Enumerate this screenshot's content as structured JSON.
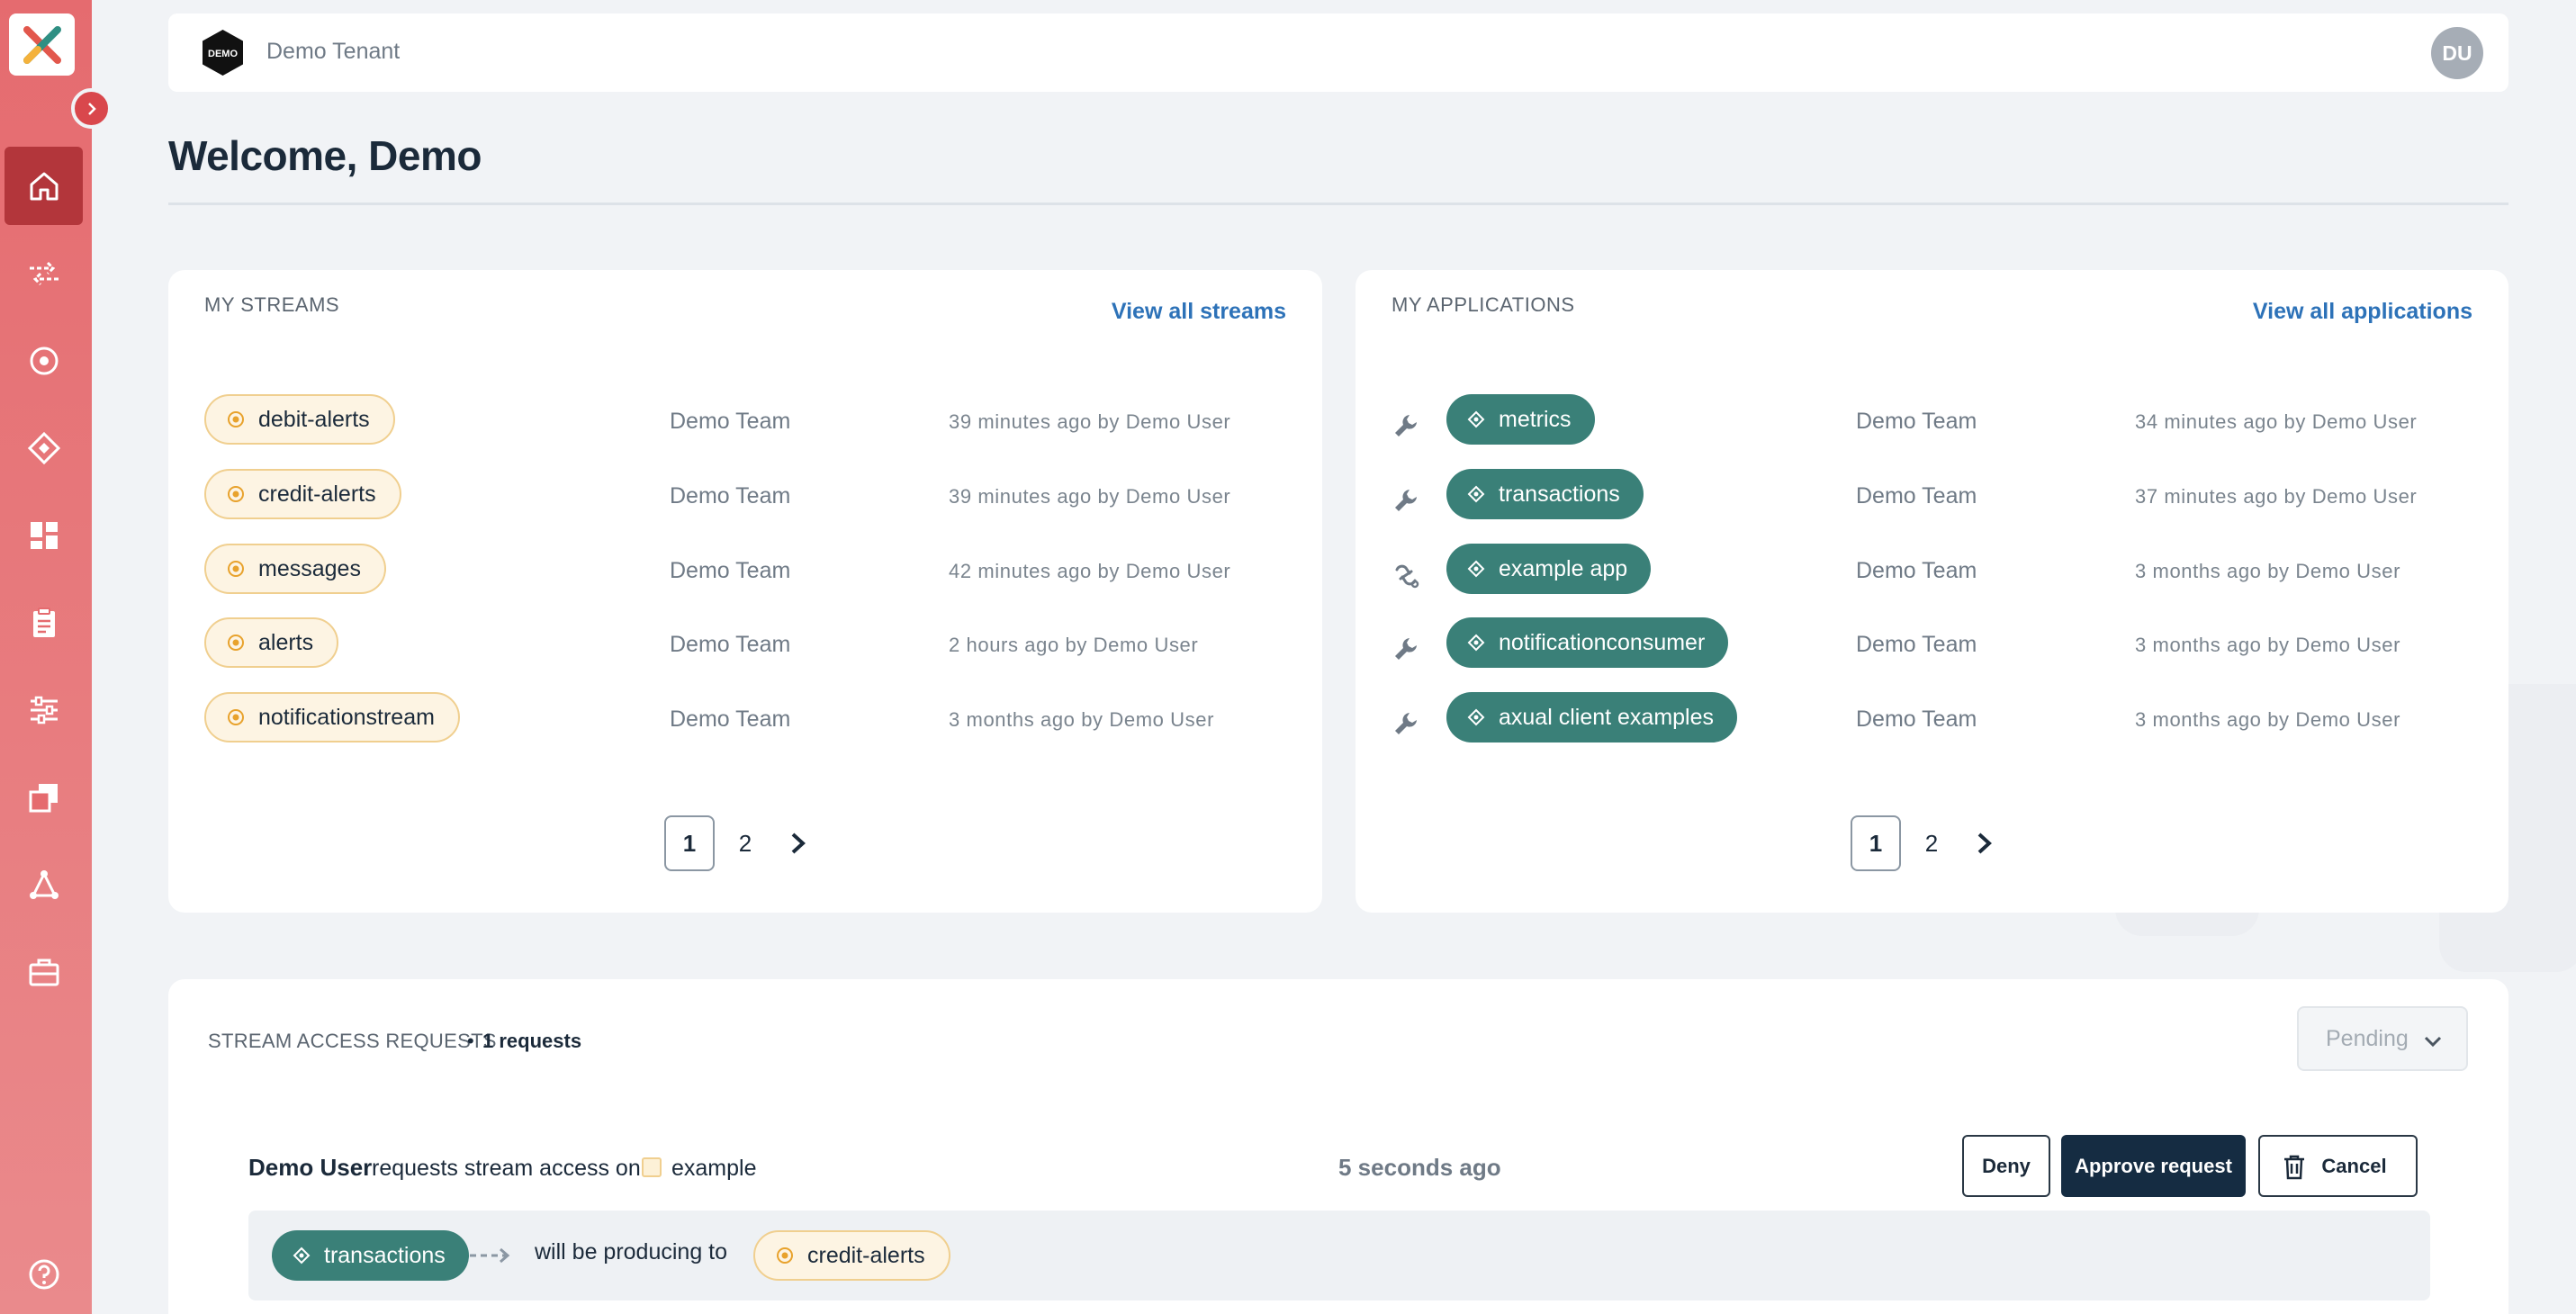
{
  "tenant": {
    "name": "Demo Tenant",
    "logo_text": "DEMO"
  },
  "user": {
    "initials": "DU"
  },
  "welcome": "Welcome, Demo",
  "sidebar": {
    "items": [
      {
        "icon": "home-icon",
        "active": true
      },
      {
        "icon": "transfer-arrows-icon"
      },
      {
        "icon": "stream-circle-icon"
      },
      {
        "icon": "application-diamond-icon"
      },
      {
        "icon": "dashboard-grid-icon"
      },
      {
        "icon": "clipboard-icon"
      },
      {
        "icon": "sliders-icon"
      },
      {
        "icon": "copy-windows-icon"
      },
      {
        "icon": "network-nodes-icon"
      },
      {
        "icon": "briefcase-icon"
      }
    ],
    "help_icon": "help-circle-icon"
  },
  "streams": {
    "title": "MY STREAMS",
    "link": "View all streams",
    "rows": [
      {
        "name": "debit-alerts",
        "team": "Demo Team",
        "time": "39 minutes ago by Demo User"
      },
      {
        "name": "credit-alerts",
        "team": "Demo Team",
        "time": "39 minutes ago by Demo User"
      },
      {
        "name": "messages",
        "team": "Demo Team",
        "time": "42 minutes ago by Demo User"
      },
      {
        "name": "alerts",
        "team": "Demo Team",
        "time": "2 hours ago by Demo User"
      },
      {
        "name": "notificationstream",
        "team": "Demo Team",
        "time": "3 months ago by Demo User"
      }
    ],
    "pages": [
      "1",
      "2"
    ]
  },
  "applications": {
    "title": "MY APPLICATIONS",
    "link": "View all applications",
    "rows": [
      {
        "name": "metrics",
        "type_icon": "wrench-icon",
        "team": "Demo Team",
        "time": "34 minutes ago by Demo User"
      },
      {
        "name": "transactions",
        "type_icon": "wrench-icon",
        "team": "Demo Team",
        "time": "37 minutes ago by Demo User"
      },
      {
        "name": "example app",
        "type_icon": "connector-icon",
        "team": "Demo Team",
        "time": "3 months ago by Demo User"
      },
      {
        "name": "notificationconsumer",
        "type_icon": "wrench-icon",
        "team": "Demo Team",
        "time": "3 months ago by Demo User"
      },
      {
        "name": "axual client examples",
        "type_icon": "wrench-icon",
        "team": "Demo Team",
        "time": "3 months ago by Demo User"
      }
    ],
    "pages": [
      "1",
      "2"
    ]
  },
  "requests": {
    "title": "STREAM ACCESS REQUESTS",
    "separator": "•",
    "count": "1 requests",
    "filter": "Pending",
    "item": {
      "user": "Demo User",
      "text": "requests stream access on",
      "target": "example",
      "time": "5 seconds ago",
      "deny": "Deny",
      "approve": "Approve request",
      "cancel": "Cancel",
      "app": "transactions",
      "detail": "will be producing to",
      "stream": "credit-alerts"
    }
  },
  "colors": {
    "sidebar": "#e56b6f",
    "active_nav": "#b3363b",
    "app_pill": "#3a8078",
    "stream_pill": "#fdf4e3",
    "link": "#2d72b8",
    "primary_button": "#152c42"
  }
}
